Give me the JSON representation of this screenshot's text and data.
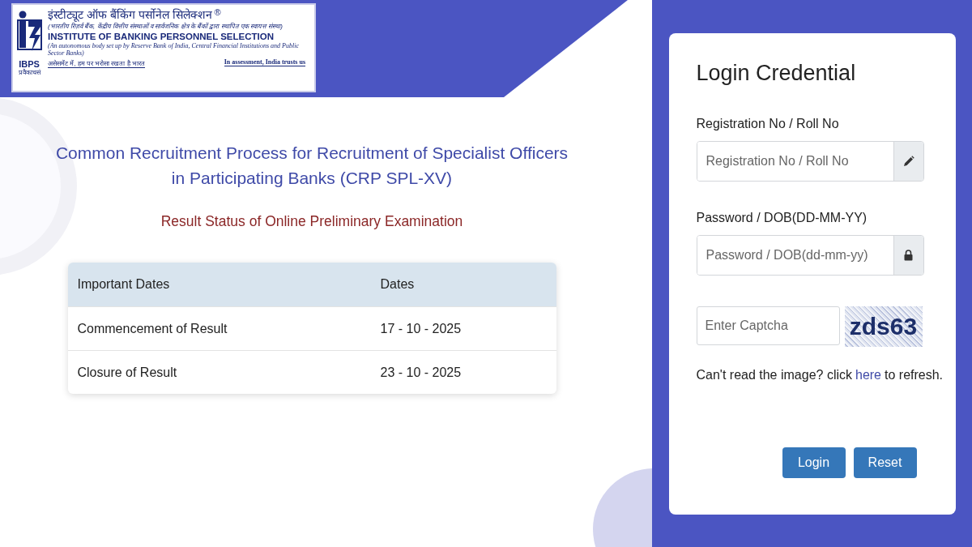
{
  "logo": {
    "hindi_name": "इंस्टीट्यूट ऑफ बैंकिंग पर्सोनेल सिलेक्शन",
    "registered_mark": "®",
    "hindi_subtitle": "(भारतीय रिज़र्व बैंक, केंद्रीय वित्तीय संस्थाओं व सार्वजनिक क्षेत्र के बैंकों द्वारा स्थापित एक स्वायत्त संस्था)",
    "english_name": "INSTITUTE OF BANKING PERSONNEL SELECTION",
    "english_subtitle": "(An autonomous body set up by Reserve Bank of India, Central Financial Institutions and Public Sector Banks)",
    "abbreviation": "IBPS",
    "hindi_abbreviation": "प्रवैकाचसं",
    "hindi_tagline": "असेसमेंट में, हम पर भरोसा रखता है भारत",
    "english_tagline": "In assessment, India trusts us"
  },
  "title": "Common Recruitment Process for Recruitment of Specialist Officers in Participating Banks (CRP SPL-XV)",
  "subtitle": "Result Status of Online Preliminary Examination",
  "table": {
    "columns": [
      "Important Dates",
      "Dates"
    ],
    "rows": [
      [
        "Commencement of Result",
        "17 - 10 - 2025"
      ],
      [
        "Closure of Result",
        "23 - 10 - 2025"
      ]
    ]
  },
  "login": {
    "title": "Login Credential",
    "fields": [
      {
        "label": "Registration No / Roll No",
        "placeholder": "Registration No / Roll No",
        "kind": "pencil"
      },
      {
        "label": "Password / DOB(DD-MM-YY)",
        "placeholder": "Password / DOB(dd-mm-yy)",
        "kind": "lock"
      }
    ],
    "captcha": {
      "placeholder": "Enter Captcha",
      "code": "zds63"
    },
    "refresh_note": {
      "before": "Can't read the image? click",
      "link": "here",
      "after": "to refresh."
    },
    "buttons": [
      "Login",
      "Reset"
    ]
  }
}
